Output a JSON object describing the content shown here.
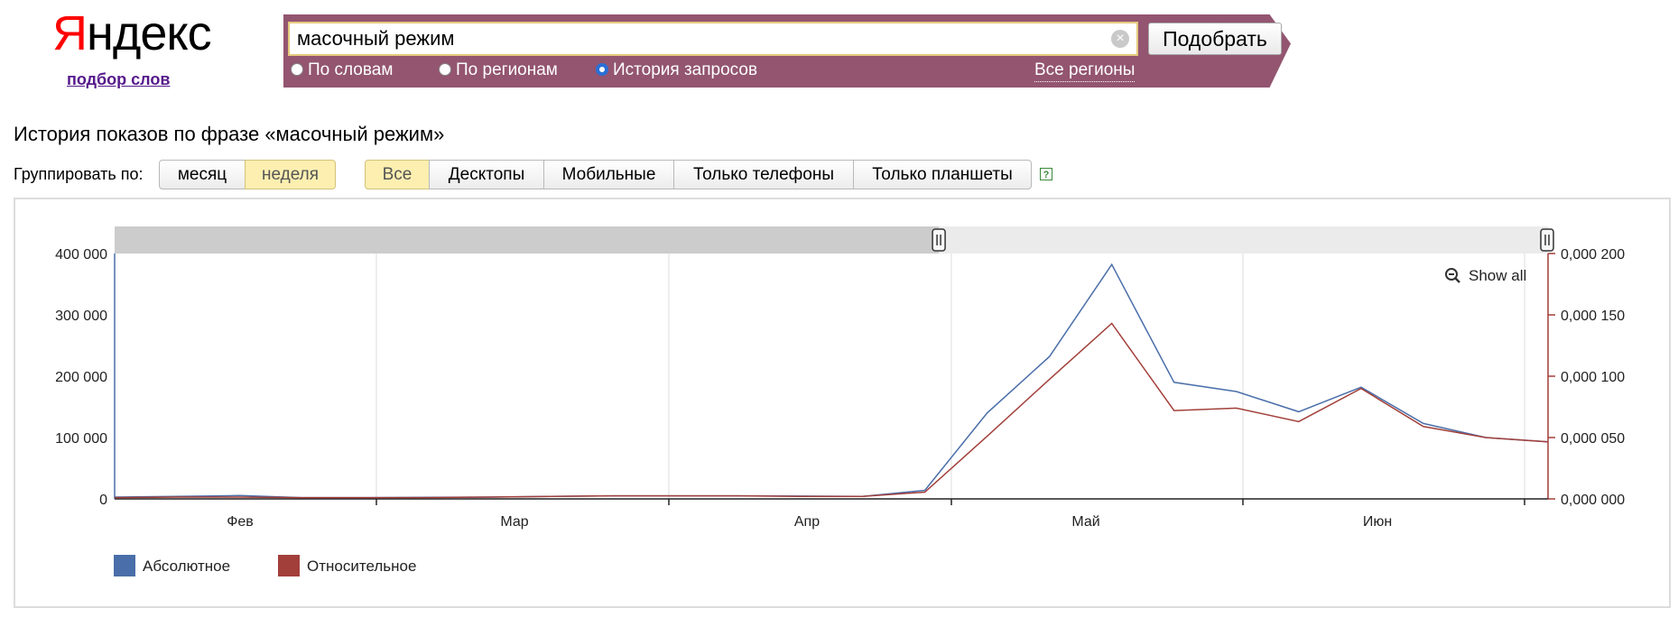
{
  "header": {
    "logo_first": "Я",
    "logo_rest": "ндекс",
    "sublink": "подбор слов"
  },
  "search": {
    "value": "масочный режим",
    "clear_icon": "clear-circle-icon",
    "submit_label": "Подобрать",
    "modes": [
      {
        "label": "По словам",
        "selected": false
      },
      {
        "label": "По регионам",
        "selected": false
      },
      {
        "label": "История запросов",
        "selected": true
      }
    ],
    "regions_link": "Все регионы",
    "bar_color": "#935570"
  },
  "toolbar": {
    "title": "История показов по фразе «масочный режим»",
    "group_label": "Группировать по:",
    "group_options": [
      {
        "label": "месяц",
        "active": false
      },
      {
        "label": "неделя",
        "active": true
      }
    ],
    "device_options": [
      {
        "label": "Все",
        "active": true
      },
      {
        "label": "Десктопы",
        "active": false
      },
      {
        "label": "Мобильные",
        "active": false
      },
      {
        "label": "Только телефоны",
        "active": false
      },
      {
        "label": "Только планшеты",
        "active": false
      }
    ],
    "help_icon": "help-question-icon"
  },
  "chart_data": {
    "type": "line",
    "show_all_label": "Show all",
    "zoom_icon": "zoom-out-icon",
    "navigator": {
      "selected_start": 0.575,
      "selected_end": 1.0
    },
    "x_tick_labels": [
      "Фев",
      "Мар",
      "Апр",
      "Май",
      "Июн"
    ],
    "y_left": {
      "ticks": [
        "0",
        "100 000",
        "200 000",
        "300 000",
        "400 000"
      ],
      "ylim": [
        0,
        400000
      ]
    },
    "y_right": {
      "ticks": [
        "0,000 000",
        "0,000 050",
        "0,000 100",
        "0,000 150",
        "0,000 200"
      ],
      "ylim": [
        0,
        0.0002
      ]
    },
    "legend_placement": "bottom-left",
    "series": [
      {
        "name": "Абсолютное",
        "color": "#4a6ea9",
        "axis": "left",
        "values": [
          3000,
          4000,
          5500,
          2000,
          2000,
          2500,
          3000,
          4000,
          5000,
          5000,
          5000,
          4500,
          4000,
          14000,
          140000,
          232000,
          382000,
          190000,
          175000,
          142000,
          182000,
          123000,
          100000,
          93000
        ]
      },
      {
        "name": "Относительное",
        "color": "#a23f3a",
        "axis": "right",
        "values": [
          1e-06,
          1.5e-06,
          1.5e-06,
          1e-06,
          1e-06,
          1e-06,
          1.5e-06,
          2e-06,
          2.5e-06,
          2.5e-06,
          2.5e-06,
          2e-06,
          2e-06,
          5.5e-06,
          5.1e-05,
          9.75e-05,
          0.000143,
          7.2e-05,
          7.4e-05,
          6.3e-05,
          9e-05,
          5.9e-05,
          5e-05,
          4.65e-05
        ]
      }
    ]
  }
}
